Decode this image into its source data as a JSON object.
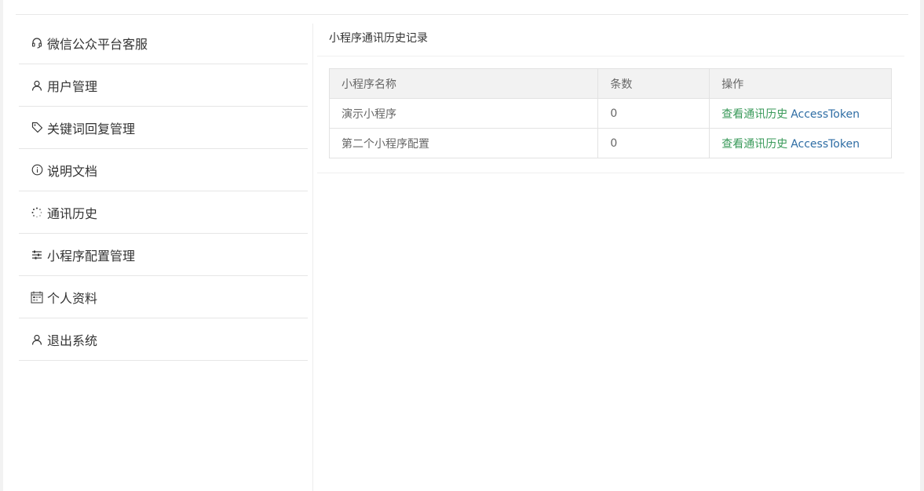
{
  "sidebar": {
    "items": [
      {
        "label": "微信公众平台客服",
        "icon": "headset-icon"
      },
      {
        "label": "用户管理",
        "icon": "user-icon"
      },
      {
        "label": "关键词回复管理",
        "icon": "tag-icon"
      },
      {
        "label": "说明文档",
        "icon": "info-icon"
      },
      {
        "label": "通讯历史",
        "icon": "loading-icon"
      },
      {
        "label": "小程序配置管理",
        "icon": "sliders-icon"
      },
      {
        "label": "个人资料",
        "icon": "calendar-icon"
      },
      {
        "label": "退出系统",
        "icon": "user-icon"
      }
    ]
  },
  "panel": {
    "title": "小程序通讯历史记录",
    "table": {
      "headers": [
        "小程序名称",
        "条数",
        "操作"
      ],
      "rows": [
        {
          "name": "演示小程序",
          "count": "0",
          "action_history": "查看通讯历史",
          "action_token": "AccessToken"
        },
        {
          "name": "第二个小程序配置",
          "count": "0",
          "action_history": "查看通讯历史",
          "action_token": "AccessToken"
        }
      ]
    }
  },
  "colors": {
    "link_green": "#3a9a5a",
    "link_blue": "#2e6da4",
    "header_bg": "#f2f2f2"
  }
}
